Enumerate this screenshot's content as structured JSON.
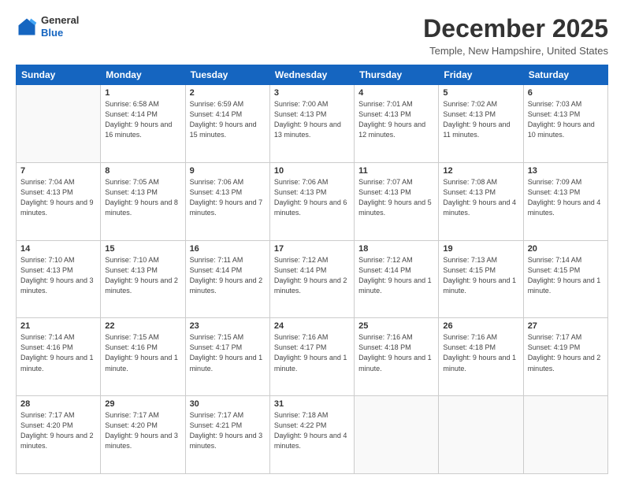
{
  "header": {
    "logo": {
      "general": "General",
      "blue": "Blue"
    },
    "title": "December 2025",
    "location": "Temple, New Hampshire, United States"
  },
  "weekdays": [
    "Sunday",
    "Monday",
    "Tuesday",
    "Wednesday",
    "Thursday",
    "Friday",
    "Saturday"
  ],
  "weeks": [
    [
      {
        "day": "",
        "sunrise": "",
        "sunset": "",
        "daylight": ""
      },
      {
        "day": "1",
        "sunrise": "Sunrise: 6:58 AM",
        "sunset": "Sunset: 4:14 PM",
        "daylight": "Daylight: 9 hours and 16 minutes."
      },
      {
        "day": "2",
        "sunrise": "Sunrise: 6:59 AM",
        "sunset": "Sunset: 4:14 PM",
        "daylight": "Daylight: 9 hours and 15 minutes."
      },
      {
        "day": "3",
        "sunrise": "Sunrise: 7:00 AM",
        "sunset": "Sunset: 4:13 PM",
        "daylight": "Daylight: 9 hours and 13 minutes."
      },
      {
        "day": "4",
        "sunrise": "Sunrise: 7:01 AM",
        "sunset": "Sunset: 4:13 PM",
        "daylight": "Daylight: 9 hours and 12 minutes."
      },
      {
        "day": "5",
        "sunrise": "Sunrise: 7:02 AM",
        "sunset": "Sunset: 4:13 PM",
        "daylight": "Daylight: 9 hours and 11 minutes."
      },
      {
        "day": "6",
        "sunrise": "Sunrise: 7:03 AM",
        "sunset": "Sunset: 4:13 PM",
        "daylight": "Daylight: 9 hours and 10 minutes."
      }
    ],
    [
      {
        "day": "7",
        "sunrise": "Sunrise: 7:04 AM",
        "sunset": "Sunset: 4:13 PM",
        "daylight": "Daylight: 9 hours and 9 minutes."
      },
      {
        "day": "8",
        "sunrise": "Sunrise: 7:05 AM",
        "sunset": "Sunset: 4:13 PM",
        "daylight": "Daylight: 9 hours and 8 minutes."
      },
      {
        "day": "9",
        "sunrise": "Sunrise: 7:06 AM",
        "sunset": "Sunset: 4:13 PM",
        "daylight": "Daylight: 9 hours and 7 minutes."
      },
      {
        "day": "10",
        "sunrise": "Sunrise: 7:06 AM",
        "sunset": "Sunset: 4:13 PM",
        "daylight": "Daylight: 9 hours and 6 minutes."
      },
      {
        "day": "11",
        "sunrise": "Sunrise: 7:07 AM",
        "sunset": "Sunset: 4:13 PM",
        "daylight": "Daylight: 9 hours and 5 minutes."
      },
      {
        "day": "12",
        "sunrise": "Sunrise: 7:08 AM",
        "sunset": "Sunset: 4:13 PM",
        "daylight": "Daylight: 9 hours and 4 minutes."
      },
      {
        "day": "13",
        "sunrise": "Sunrise: 7:09 AM",
        "sunset": "Sunset: 4:13 PM",
        "daylight": "Daylight: 9 hours and 4 minutes."
      }
    ],
    [
      {
        "day": "14",
        "sunrise": "Sunrise: 7:10 AM",
        "sunset": "Sunset: 4:13 PM",
        "daylight": "Daylight: 9 hours and 3 minutes."
      },
      {
        "day": "15",
        "sunrise": "Sunrise: 7:10 AM",
        "sunset": "Sunset: 4:13 PM",
        "daylight": "Daylight: 9 hours and 2 minutes."
      },
      {
        "day": "16",
        "sunrise": "Sunrise: 7:11 AM",
        "sunset": "Sunset: 4:14 PM",
        "daylight": "Daylight: 9 hours and 2 minutes."
      },
      {
        "day": "17",
        "sunrise": "Sunrise: 7:12 AM",
        "sunset": "Sunset: 4:14 PM",
        "daylight": "Daylight: 9 hours and 2 minutes."
      },
      {
        "day": "18",
        "sunrise": "Sunrise: 7:12 AM",
        "sunset": "Sunset: 4:14 PM",
        "daylight": "Daylight: 9 hours and 1 minute."
      },
      {
        "day": "19",
        "sunrise": "Sunrise: 7:13 AM",
        "sunset": "Sunset: 4:15 PM",
        "daylight": "Daylight: 9 hours and 1 minute."
      },
      {
        "day": "20",
        "sunrise": "Sunrise: 7:14 AM",
        "sunset": "Sunset: 4:15 PM",
        "daylight": "Daylight: 9 hours and 1 minute."
      }
    ],
    [
      {
        "day": "21",
        "sunrise": "Sunrise: 7:14 AM",
        "sunset": "Sunset: 4:16 PM",
        "daylight": "Daylight: 9 hours and 1 minute."
      },
      {
        "day": "22",
        "sunrise": "Sunrise: 7:15 AM",
        "sunset": "Sunset: 4:16 PM",
        "daylight": "Daylight: 9 hours and 1 minute."
      },
      {
        "day": "23",
        "sunrise": "Sunrise: 7:15 AM",
        "sunset": "Sunset: 4:17 PM",
        "daylight": "Daylight: 9 hours and 1 minute."
      },
      {
        "day": "24",
        "sunrise": "Sunrise: 7:16 AM",
        "sunset": "Sunset: 4:17 PM",
        "daylight": "Daylight: 9 hours and 1 minute."
      },
      {
        "day": "25",
        "sunrise": "Sunrise: 7:16 AM",
        "sunset": "Sunset: 4:18 PM",
        "daylight": "Daylight: 9 hours and 1 minute."
      },
      {
        "day": "26",
        "sunrise": "Sunrise: 7:16 AM",
        "sunset": "Sunset: 4:18 PM",
        "daylight": "Daylight: 9 hours and 1 minute."
      },
      {
        "day": "27",
        "sunrise": "Sunrise: 7:17 AM",
        "sunset": "Sunset: 4:19 PM",
        "daylight": "Daylight: 9 hours and 2 minutes."
      }
    ],
    [
      {
        "day": "28",
        "sunrise": "Sunrise: 7:17 AM",
        "sunset": "Sunset: 4:20 PM",
        "daylight": "Daylight: 9 hours and 2 minutes."
      },
      {
        "day": "29",
        "sunrise": "Sunrise: 7:17 AM",
        "sunset": "Sunset: 4:20 PM",
        "daylight": "Daylight: 9 hours and 3 minutes."
      },
      {
        "day": "30",
        "sunrise": "Sunrise: 7:17 AM",
        "sunset": "Sunset: 4:21 PM",
        "daylight": "Daylight: 9 hours and 3 minutes."
      },
      {
        "day": "31",
        "sunrise": "Sunrise: 7:18 AM",
        "sunset": "Sunset: 4:22 PM",
        "daylight": "Daylight: 9 hours and 4 minutes."
      },
      {
        "day": "",
        "sunrise": "",
        "sunset": "",
        "daylight": ""
      },
      {
        "day": "",
        "sunrise": "",
        "sunset": "",
        "daylight": ""
      },
      {
        "day": "",
        "sunrise": "",
        "sunset": "",
        "daylight": ""
      }
    ]
  ]
}
